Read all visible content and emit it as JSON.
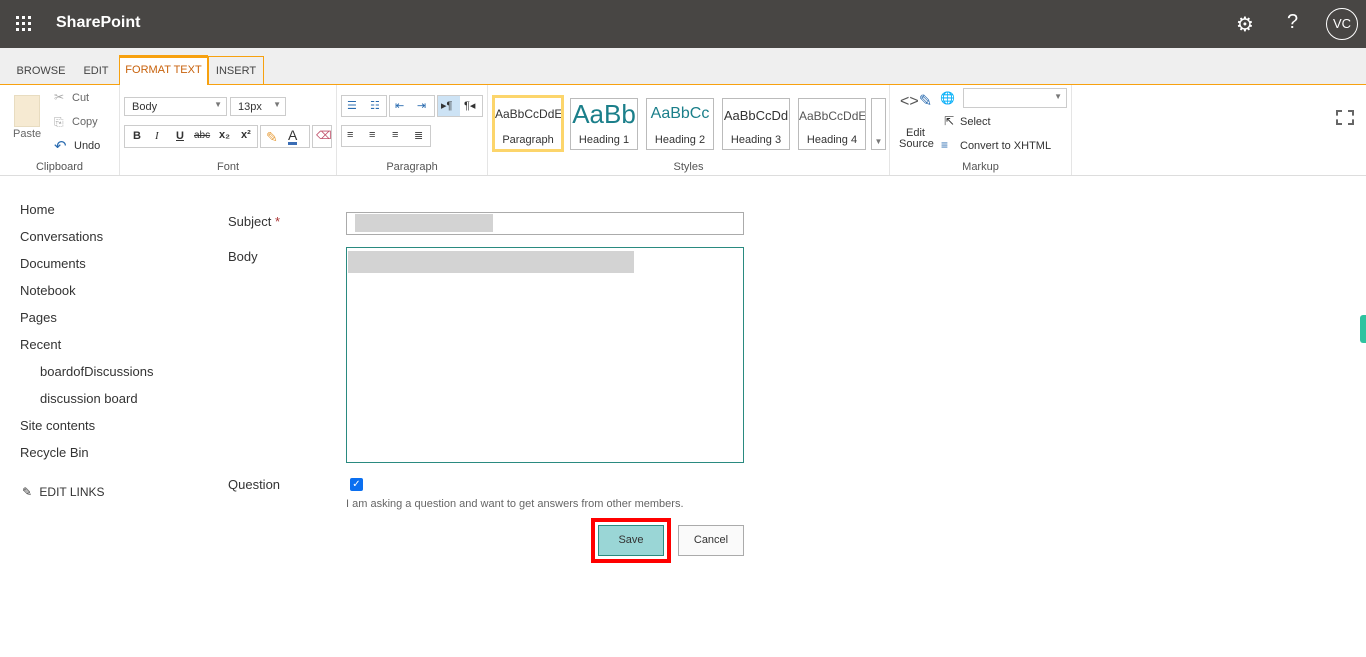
{
  "topbar": {
    "app_title": "SharePoint",
    "avatar_initials": "VC",
    "icons": [
      "waffle-icon",
      "gear-icon",
      "help-icon"
    ]
  },
  "tabs": [
    {
      "label": "BROWSE"
    },
    {
      "label": "EDIT"
    },
    {
      "label": "FORMAT TEXT",
      "active": true
    },
    {
      "label": "INSERT"
    }
  ],
  "ribbon": {
    "clipboard": {
      "label": "Clipboard",
      "paste": "Paste",
      "cut": "Cut",
      "copy": "Copy",
      "undo": "Undo"
    },
    "font": {
      "label": "Font",
      "font_name": "Body",
      "font_size": "13px",
      "bold": "B",
      "italic": "I",
      "underline": "U",
      "strike": "abc",
      "sub": "x₂",
      "sup": "x²"
    },
    "paragraph": {
      "label": "Paragraph"
    },
    "styles": {
      "label": "Styles",
      "items": [
        {
          "preview": "AaBbCcDdE",
          "name": "Paragraph",
          "selected": true
        },
        {
          "preview": "AaBb",
          "name": "Heading 1"
        },
        {
          "preview": "AaBbCc",
          "name": "Heading 2"
        },
        {
          "preview": "AaBbCcDd",
          "name": "Heading 3"
        },
        {
          "preview": "AaBbCcDdE",
          "name": "Heading 4"
        }
      ]
    },
    "markup": {
      "label": "Markup",
      "edit_source_1": "Edit",
      "edit_source_2": "Source",
      "select": "Select",
      "convert": "Convert to XHTML",
      "language_value": ""
    }
  },
  "nav": {
    "items": [
      "Home",
      "Conversations",
      "Documents",
      "Notebook",
      "Pages",
      "Recent"
    ],
    "sub_items": [
      "boardofDiscussions",
      "discussion board"
    ],
    "items2": [
      "Site contents",
      "Recycle Bin"
    ],
    "edit_links": "EDIT LINKS"
  },
  "form": {
    "subject_label": "Subject",
    "required_mark": "*",
    "body_label": "Body",
    "question_label": "Question",
    "question_checked": true,
    "question_help": "I am asking a question and want to get answers from other members.",
    "save": "Save",
    "cancel": "Cancel"
  },
  "colors": {
    "topbar": "#484644",
    "accent": "#f7a10f",
    "teal": "#038387",
    "save_bg": "#9ad6d6",
    "highlight": "#ff0000"
  }
}
